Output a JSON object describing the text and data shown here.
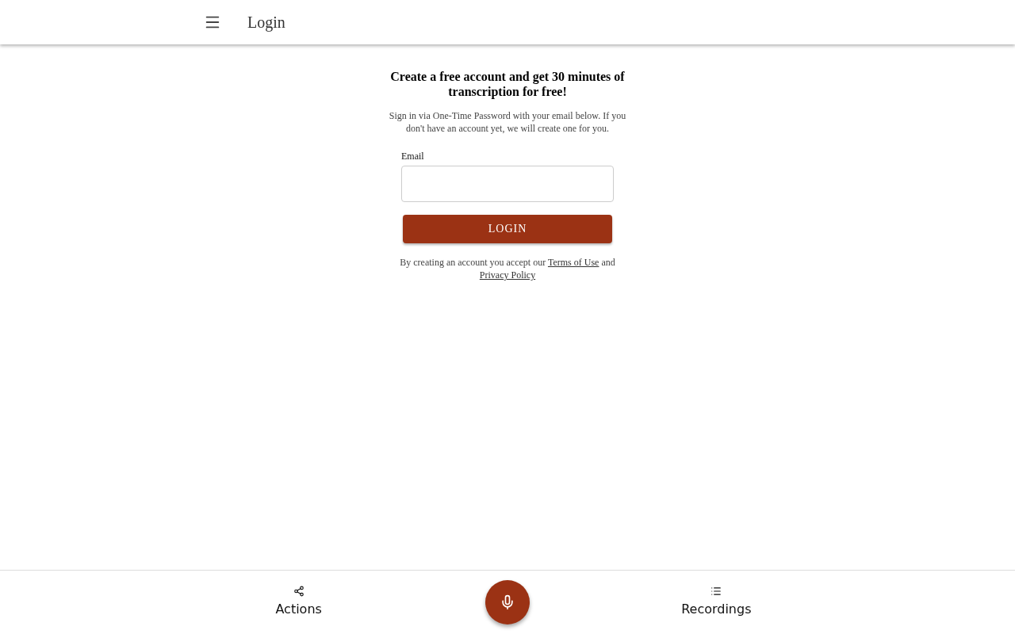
{
  "app_bar": {
    "title": "Login"
  },
  "login": {
    "heading": "Create a free account and get 30 minutes of transcription for free!",
    "intro": "Sign in via One-Time Password with your email below. If you don't have an account yet, we will create one for you.",
    "email_label": "Email",
    "button": "LOGIN",
    "terms": [
      {
        "kind": "text",
        "text": "By creating an account you accept our "
      },
      {
        "kind": "link",
        "text": "Terms of Use"
      },
      {
        "kind": "text",
        "text": " and "
      },
      {
        "kind": "link",
        "text": "Privacy Policy"
      }
    ]
  },
  "bottom_nav": [
    {
      "kind": "share",
      "label": "Actions"
    },
    {
      "kind": "record"
    },
    {
      "kind": "list",
      "label": "Recordings"
    }
  ]
}
